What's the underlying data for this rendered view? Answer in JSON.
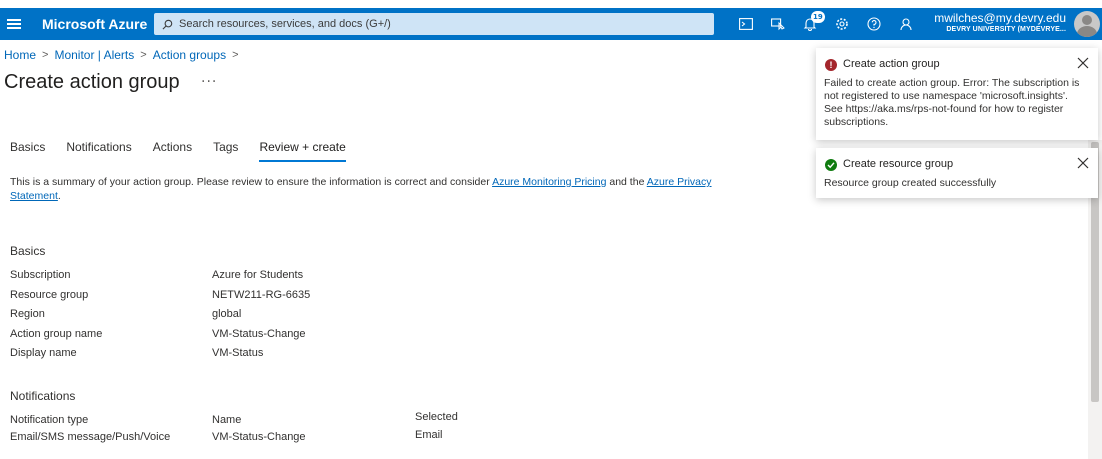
{
  "topbar": {
    "brand": "Microsoft Azure",
    "search_placeholder": "Search resources, services, and docs (G+/)",
    "notification_count": "19",
    "account_email": "mwilches@my.devry.edu",
    "account_org": "DEVRY UNIVERSITY (MYDEVRYE..."
  },
  "breadcrumb": {
    "items": [
      "Home",
      "Monitor | Alerts",
      "Action groups"
    ],
    "separator": ">"
  },
  "page": {
    "title": "Create action group",
    "more": "···"
  },
  "tabs": [
    {
      "label": "Basics"
    },
    {
      "label": "Notifications"
    },
    {
      "label": "Actions"
    },
    {
      "label": "Tags"
    },
    {
      "label": "Review + create"
    }
  ],
  "summary": {
    "text_before": "This is a summary of your action group. Please review to ensure the information is correct and consider ",
    "link1": "Azure Monitoring Pricing",
    "text_mid": " and the ",
    "link2": "Azure Privacy Statement",
    "text_after": "."
  },
  "basics": {
    "title": "Basics",
    "rows": [
      {
        "label": "Subscription",
        "value": "Azure for Students"
      },
      {
        "label": "Resource group",
        "value": "NETW211-RG-6635"
      },
      {
        "label": "Region",
        "value": "global"
      },
      {
        "label": "Action group name",
        "value": "VM-Status-Change"
      },
      {
        "label": "Display name",
        "value": "VM-Status"
      }
    ]
  },
  "notifications": {
    "title": "Notifications",
    "headers": [
      "Notification type",
      "Name",
      "Selected"
    ],
    "rows": [
      {
        "type": "Email/SMS message/Push/Voice",
        "name": "VM-Status-Change",
        "selected": "Email"
      }
    ]
  },
  "toasts": [
    {
      "title": "Create action group",
      "status": "error",
      "message": "Failed to create action group. Error: The subscription is not registered to use namespace 'microsoft.insights'. See https://aka.ms/rps-not-found for how to register subscriptions."
    },
    {
      "title": "Create resource group",
      "status": "success",
      "message": "Resource group created successfully"
    }
  ],
  "colors": {
    "brand_blue": "#0072c6",
    "link": "#0067b8",
    "error": "#a4262c",
    "success": "#107c10"
  }
}
